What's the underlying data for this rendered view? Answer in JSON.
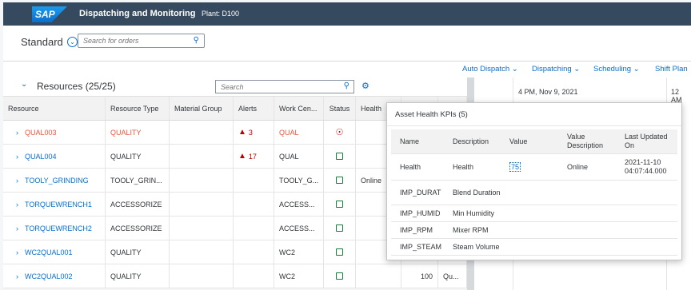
{
  "shell": {
    "logo": "SAP",
    "title": "Dispatching and Monitoring",
    "plant": "Plant: D100"
  },
  "header": {
    "variant": "Standard",
    "search_placeholder": "Search for orders"
  },
  "toolbar": [
    "Auto Dispatch",
    "Dispatching",
    "Scheduling",
    "Shift Plan"
  ],
  "resources": {
    "title": "Resources (25/25)",
    "search_placeholder": "Search"
  },
  "table": {
    "columns": [
      "Resource",
      "Resource Type",
      "Material Group",
      "Alerts",
      "Work Cen...",
      "Status",
      "Health"
    ],
    "rows": [
      {
        "resource": "QUAL003",
        "type": "QUALITY",
        "alerts": "3",
        "wc": "QUAL",
        "status": "down",
        "health": "",
        "extra": "",
        "extra2": "",
        "highlight": true
      },
      {
        "resource": "QUAL004",
        "type": "QUALITY",
        "alerts": "17",
        "wc": "QUAL",
        "status": "ok",
        "health": "",
        "extra": "",
        "extra2": "",
        "highlight": false
      },
      {
        "resource": "TOOLY_GRINDING",
        "type": "TOOLY_GRIN...",
        "alerts": "",
        "wc": "TOOLY_G...",
        "status": "ok",
        "health": "Online",
        "extra": "",
        "extra2": "",
        "highlight": false
      },
      {
        "resource": "TORQUEWRENCH1",
        "type": "ACCESSORIZE",
        "alerts": "",
        "wc": "ACCESS...",
        "status": "ok",
        "health": "",
        "extra": "",
        "extra2": "",
        "highlight": false
      },
      {
        "resource": "TORQUEWRENCH2",
        "type": "ACCESSORIZE",
        "alerts": "",
        "wc": "ACCESS...",
        "status": "ok",
        "health": "",
        "extra": "",
        "extra2": "",
        "highlight": false
      },
      {
        "resource": "WC2QUAL001",
        "type": "QUALITY",
        "alerts": "",
        "wc": "WC2",
        "status": "ok",
        "health": "",
        "extra": "",
        "extra2": "",
        "highlight": false
      },
      {
        "resource": "WC2QUAL002",
        "type": "QUALITY",
        "alerts": "",
        "wc": "WC2",
        "status": "ok",
        "health": "",
        "extra": "100",
        "extra2": "Qu...",
        "highlight": false
      }
    ]
  },
  "gantt": {
    "time1": "4 PM, Nov 9, 2021",
    "time2": "12 AM"
  },
  "popover": {
    "title": "Asset Health KPIs (5)",
    "columns": [
      "Name",
      "Description",
      "Value",
      "Value Description",
      "Last Updated On"
    ],
    "rows": [
      {
        "name": "Health",
        "desc": "Health",
        "value": "75",
        "vdesc": "Online",
        "updated": "2021-11-10 04:07:44.000"
      },
      {
        "name": "IMP_DURAT",
        "desc": "Blend Duration",
        "value": "",
        "vdesc": "",
        "updated": ""
      },
      {
        "name": "IMP_HUMID",
        "desc": "Min Humidity",
        "value": "",
        "vdesc": "",
        "updated": ""
      },
      {
        "name": "IMP_RPM",
        "desc": "Mixer RPM",
        "value": "",
        "vdesc": "",
        "updated": ""
      },
      {
        "name": "IMP_STEAM",
        "desc": "Steam Volume",
        "value": "",
        "vdesc": "",
        "updated": ""
      }
    ]
  },
  "colors": {
    "shell": "#354a5f",
    "accent": "#0a6ed1",
    "alert": "#bb0000",
    "ok": "#107e3e",
    "highlight_text": "#e9573f"
  }
}
